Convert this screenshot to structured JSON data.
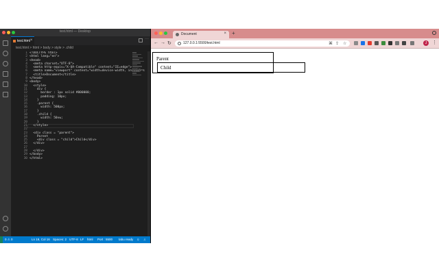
{
  "vscode": {
    "window_title": "test.html — Desktop",
    "tab_label": "test.html",
    "breadcrumb": "test.html > html > body > style > .child",
    "line_numbers": [
      "1",
      "2",
      "3",
      "4",
      "5",
      "6",
      "7",
      "8",
      "9",
      "10",
      "11",
      "12",
      "13",
      "14",
      "15",
      "16",
      "17",
      "18",
      "19",
      "20",
      "21",
      "22",
      "23",
      "24",
      "25",
      "26",
      "27",
      "28",
      "29",
      "30"
    ],
    "code_lines": [
      "<!DOCTYPE html>",
      "<html lang=\"en\">",
      "<head>",
      "  <meta charset=\"UTF-8\">",
      "  <meta http-equiv=\"X-UA-Compatible\" content=\"IE=edge\">",
      "  <meta name=\"viewport\" content=\"width=device-width, initial-s",
      "  <title>Document</title>",
      "</head>",
      "<body>",
      "  <style>",
      "    div {",
      "      border : 1px solid #000000;",
      "      padding: 10px;",
      "    }",
      "    .parent {",
      "      width: 500px;",
      "    }",
      "    .child {",
      "      width: 50vw;",
      "    }",
      "  </style>",
      "",
      "  <div class = \"parent\">",
      "    Parent",
      "    <div class = \"child\">Child</div>",
      "  </div>",
      "",
      "  </div>",
      "</body>",
      "</html>"
    ],
    "status": {
      "errors": "0 ⚠ 0",
      "position": "Ln 19, Col 16",
      "spaces": "Spaces: 2",
      "encoding": "UTF-8",
      "eol": "LF",
      "language": "html",
      "port": "Port : 5500",
      "prettier": "tabu ready"
    }
  },
  "browser": {
    "tab_title": "Document",
    "url": "127.0.0.1:5500/test.html",
    "page": {
      "parent_text": "Parent",
      "child_text": "Child"
    }
  },
  "colors": {
    "vscode_bg": "#1e1e1e",
    "statusbar": "#007acc",
    "browser_tabstrip": "#d78c8c",
    "browser_toolbar": "#f0d6d6"
  }
}
